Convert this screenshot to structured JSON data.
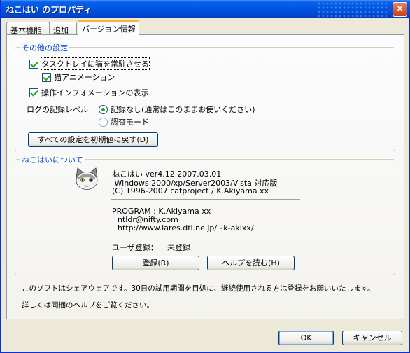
{
  "window": {
    "title": "ねこはい のプロパティ",
    "close_glyph": "✕"
  },
  "tabs": [
    {
      "label": "基本機能"
    },
    {
      "label": "追加"
    },
    {
      "label": "バージョン情報"
    }
  ],
  "other_settings": {
    "legend": "その他の設定",
    "tasktray_label": "タスクトレイに猫を常駐させる",
    "tasktray_checked": true,
    "animation_label": "猫アニメーション",
    "animation_checked": true,
    "info_display_label": "操作インフォメーションの表示",
    "info_display_checked": true,
    "log_level_label": "ログの記録レベル",
    "log_options": [
      {
        "label": "記録なし(通常はこのままお使いください)",
        "selected": true
      },
      {
        "label": "調査モード",
        "selected": false
      }
    ],
    "reset_button": "すべての設定を初期値に戻す(D)"
  },
  "about": {
    "legend": "ねこはいについて",
    "icon": "cat-face-icon",
    "version_line": "ねこはい ver4.12   2007.03.01",
    "platform_line": " Windows 2000/xp/Server2003/Vista 対応版",
    "copyright_line": "(C) 1996-2007 catproject / K.Akiyama xx",
    "program_line": "PROGRAM : K.Akiyama xx",
    "email_line": "ntldr@nifty.com",
    "url_line": "http://www.lares.dti.ne.jp/~k-akixx/",
    "user_reg_label": "ユーザ登録：",
    "user_reg_status": "未登録",
    "register_button": "登録(R)",
    "help_button": "ヘルプを読む(H)"
  },
  "notice": {
    "line1": "このソフトはシェアウェアです。30日の試用期間を目処に、継続使用される方は登録をお願いいたします。",
    "line2": "詳しくは同梱のヘルプをご覧ください。"
  },
  "footer": {
    "ok": "OK",
    "cancel": "キャンセル"
  },
  "colors": {
    "title_bar": "#0054e3",
    "group_legend": "#0046d5",
    "check_mark": "#21a121",
    "active_tab_accent": "#f8b239"
  }
}
